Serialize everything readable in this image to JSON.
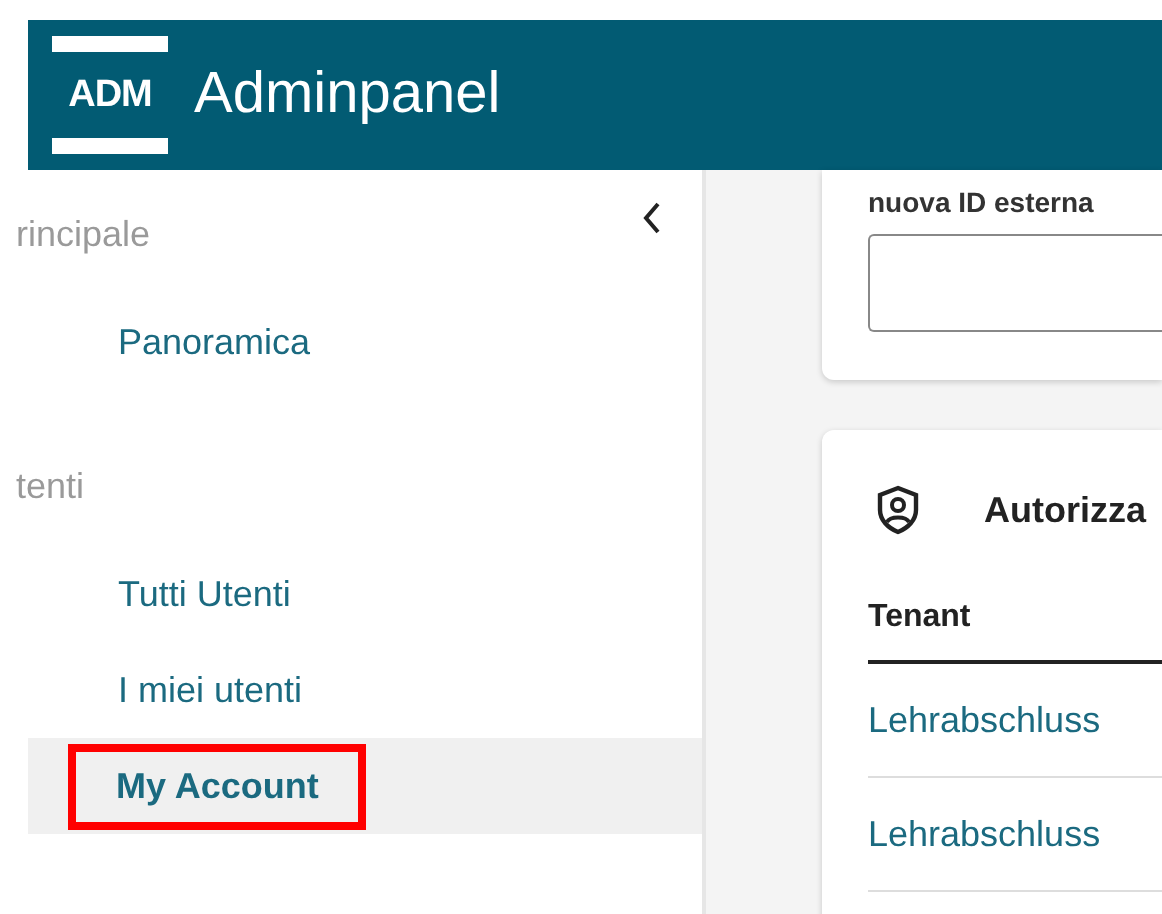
{
  "header": {
    "logo": "ADM",
    "title": "Adminpanel"
  },
  "sidebar": {
    "sections": [
      {
        "heading": "rincipale",
        "items": [
          {
            "label": "Panoramica",
            "selected": false,
            "highlighted": false
          }
        ]
      },
      {
        "heading": "tenti",
        "items": [
          {
            "label": "Tutti Utenti",
            "selected": false,
            "highlighted": false
          },
          {
            "label": "I miei utenti",
            "selected": false,
            "highlighted": false
          },
          {
            "label": "My Account",
            "selected": true,
            "highlighted": true
          }
        ]
      }
    ]
  },
  "id_card": {
    "label": "nuova ID esterna"
  },
  "permissions_card": {
    "title": "Autorizza",
    "table": {
      "columns": [
        "Tenant"
      ],
      "rows": [
        [
          "Lehrabschluss"
        ],
        [
          "Lehrabschluss"
        ]
      ]
    }
  }
}
